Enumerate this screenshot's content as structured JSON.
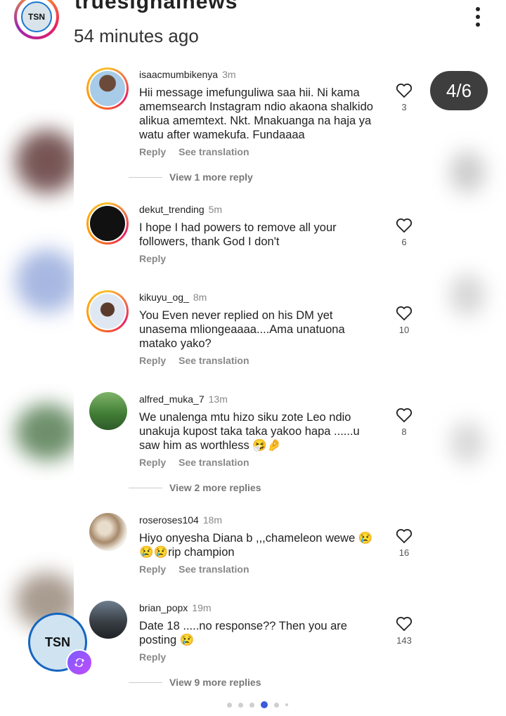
{
  "header": {
    "account_name": "truesignalnews",
    "time": "54 minutes ago",
    "logo_text": "TSN"
  },
  "page_indicator": "4/6",
  "comments": [
    {
      "username": "isaacmumbikenya",
      "time": "3m",
      "text": "Hii message imefunguliwa saa hii. Ni kama amemsearch Instagram ndio akaona shalkido alikua amemtext. Nkt. Mnakuanga na haja ya watu after wamekufa. Fundaaaa",
      "likes": "3",
      "reply": "Reply",
      "translate": "See translation",
      "more_replies": "View 1 more reply"
    },
    {
      "username": "dekut_trending",
      "time": "5m",
      "text": "I hope I had powers to remove all your followers, thank God I don't",
      "likes": "6",
      "reply": "Reply"
    },
    {
      "username": "kikuyu_og_",
      "time": "8m",
      "text": "You Even never replied on his DM yet unasema mliongeaaaa....Ama unatuona matako yako?",
      "likes": "10",
      "reply": "Reply",
      "translate": "See translation"
    },
    {
      "username": "alfred_muka_7",
      "time": "13m",
      "text": "We unalenga mtu hizo siku zote Leo ndio unakuja kupost taka taka yakoo hapa ......u saw him as worthless 🤧🤌",
      "likes": "8",
      "reply": "Reply",
      "translate": "See translation",
      "more_replies": "View 2 more replies"
    },
    {
      "username": "roseroses104",
      "time": "18m",
      "text": "Hiyo onyesha Diana b ,,,chameleon wewe 😢😢😢rip champion",
      "likes": "16",
      "reply": "Reply",
      "translate": "See translation"
    },
    {
      "username": "brian_popx",
      "time": "19m",
      "text": "Date 18 .....no response?? Then you are posting 😢",
      "likes": "143",
      "reply": "Reply",
      "more_replies": "View 9 more replies"
    }
  ],
  "carousel": {
    "total_dots": 6,
    "active_index": 3
  },
  "colors": {
    "accent": "#3b5bdb",
    "badge_bg": "#3e3e3e",
    "repost": "#7b5cff"
  },
  "icons": [
    "heart-icon",
    "more-vertical-icon",
    "repost-icon"
  ]
}
